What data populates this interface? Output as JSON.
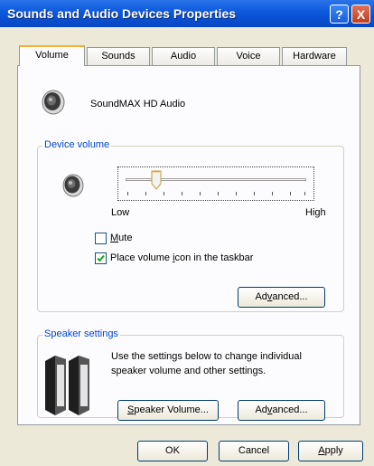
{
  "window": {
    "title": "Sounds and Audio Devices Properties",
    "help_glyph": "?",
    "close_glyph": "X"
  },
  "tabs": [
    {
      "label": "Volume",
      "active": true
    },
    {
      "label": "Sounds",
      "active": false
    },
    {
      "label": "Audio",
      "active": false
    },
    {
      "label": "Voice",
      "active": false
    },
    {
      "label": "Hardware",
      "active": false
    }
  ],
  "device": {
    "name": "SoundMAX HD Audio",
    "icon": "speaker-icon"
  },
  "device_volume": {
    "legend": "Device volume",
    "low_label": "Low",
    "high_label": "High",
    "level": 0.17,
    "mute": {
      "label_pre": "",
      "label_u": "M",
      "label_post": "ute",
      "checked": false
    },
    "taskbar": {
      "label_pre": "Place volume ",
      "label_u": "i",
      "label_post": "con in the taskbar",
      "checked": true
    },
    "advanced_label": {
      "pre": "Ad",
      "u": "v",
      "post": "anced..."
    }
  },
  "speaker_settings": {
    "legend": "Speaker settings",
    "description": "Use the settings below to change individual speaker volume and other settings.",
    "speaker_volume_label": {
      "pre": "",
      "u": "S",
      "post": "peaker Volume..."
    },
    "advanced_label": {
      "pre": "Ad",
      "u": "v",
      "post": "anced..."
    },
    "icon": "speakers-icon"
  },
  "footer": {
    "ok_label": "OK",
    "cancel_label": "Cancel",
    "apply_label": {
      "pre": "",
      "u": "A",
      "post": "pply"
    }
  }
}
